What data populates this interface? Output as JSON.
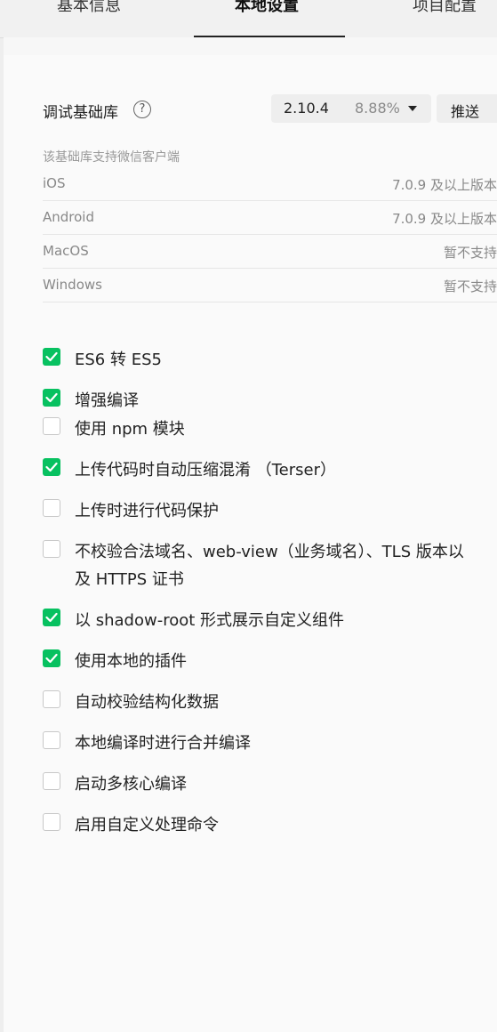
{
  "tabs": {
    "items": [
      "基本信息",
      "本地设置",
      "项目配置"
    ],
    "active_index": 1
  },
  "base_lib": {
    "label": "调试基础库",
    "help_icon": "?",
    "version": "2.10.4",
    "coverage": "8.88%",
    "push_label": "推送"
  },
  "support": {
    "title": "该基础库支持微信客户端",
    "rows": [
      {
        "os": "iOS",
        "version": "7.0.9 及以上版本"
      },
      {
        "os": "Android",
        "version": "7.0.9 及以上版本"
      },
      {
        "os": "MacOS",
        "version": "暂不支持"
      },
      {
        "os": "Windows",
        "version": "暂不支持"
      }
    ]
  },
  "options": [
    {
      "label": "ES6 转 ES5",
      "checked": true
    },
    {
      "label": "增强编译",
      "checked": true
    },
    {
      "label": "使用 npm 模块",
      "checked": false
    },
    {
      "label": "上传代码时自动压缩混淆 （Terser）",
      "checked": true
    },
    {
      "label": "上传时进行代码保护",
      "checked": false
    },
    {
      "label": "不校验合法域名、web-view（业务域名）、TLS 版本以及 HTTPS 证书",
      "checked": false
    },
    {
      "label": "以 shadow-root 形式展示自定义组件",
      "checked": true
    },
    {
      "label": "使用本地的插件",
      "checked": true
    },
    {
      "label": "自动校验结构化数据",
      "checked": false
    },
    {
      "label": "本地编译时进行合并编译",
      "checked": false
    },
    {
      "label": "启动多核心编译",
      "checked": false
    },
    {
      "label": "启用自定义处理命令",
      "checked": false
    }
  ],
  "colors": {
    "checked": "#07c160"
  }
}
